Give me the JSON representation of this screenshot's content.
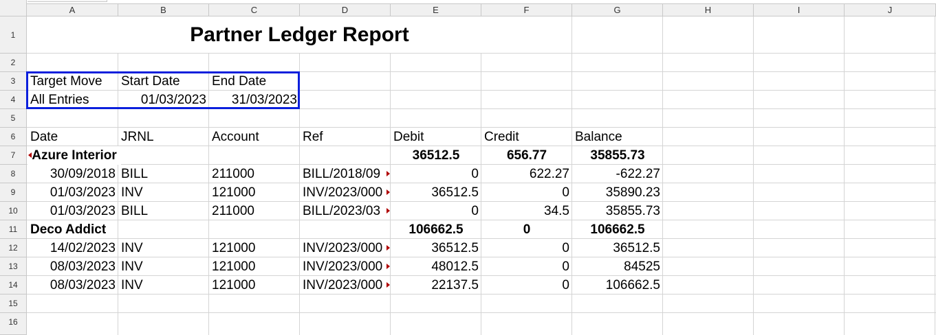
{
  "columns": [
    "A",
    "B",
    "C",
    "D",
    "E",
    "F",
    "G",
    "H",
    "I",
    "J"
  ],
  "rows": [
    "1",
    "2",
    "3",
    "4",
    "5",
    "6",
    "7",
    "8",
    "9",
    "10",
    "11",
    "12",
    "13",
    "14",
    "15",
    "16"
  ],
  "report": {
    "title": "Partner Ledger Report",
    "filters": {
      "target_move_label": "Target Move",
      "start_date_label": "Start Date",
      "end_date_label": "End Date",
      "target_move": "All Entries",
      "start_date": "01/03/2023",
      "end_date": "31/03/2023"
    },
    "headers": [
      "Date",
      "JRNL",
      "Account",
      "Ref",
      "Debit",
      "Credit",
      "Balance"
    ],
    "partners": [
      {
        "name": "Azure Interior",
        "debit": "36512.5",
        "credit": "656.77",
        "balance": "35855.73",
        "lines": [
          {
            "date": "30/09/2018",
            "jrnl": "BILL",
            "account": "211000",
            "ref": "BILL/2018/09",
            "debit": "0",
            "credit": "622.27",
            "balance": "-622.27"
          },
          {
            "date": "01/03/2023",
            "jrnl": "INV",
            "account": "121000",
            "ref": "INV/2023/000",
            "debit": "36512.5",
            "credit": "0",
            "balance": "35890.23"
          },
          {
            "date": "01/03/2023",
            "jrnl": "BILL",
            "account": "211000",
            "ref": "BILL/2023/03",
            "debit": "0",
            "credit": "34.5",
            "balance": "35855.73"
          }
        ]
      },
      {
        "name": "Deco Addict",
        "debit": "106662.5",
        "credit": "0",
        "balance": "106662.5",
        "lines": [
          {
            "date": "14/02/2023",
            "jrnl": "INV",
            "account": "121000",
            "ref": "INV/2023/000",
            "debit": "36512.5",
            "credit": "0",
            "balance": "36512.5"
          },
          {
            "date": "08/03/2023",
            "jrnl": "INV",
            "account": "121000",
            "ref": "INV/2023/000",
            "debit": "48012.5",
            "credit": "0",
            "balance": "84525"
          },
          {
            "date": "08/03/2023",
            "jrnl": "INV",
            "account": "121000",
            "ref": "INV/2023/000",
            "debit": "22137.5",
            "credit": "0",
            "balance": "106662.5"
          }
        ]
      }
    ]
  }
}
